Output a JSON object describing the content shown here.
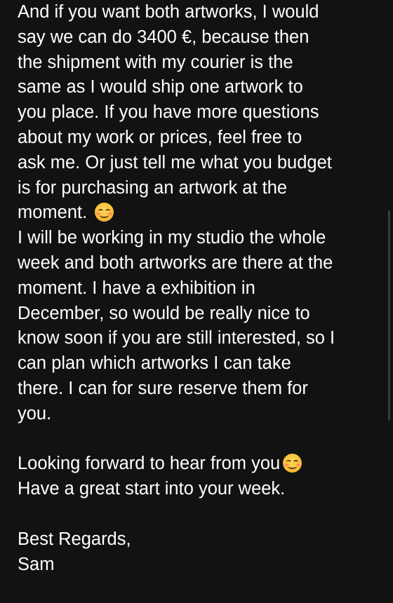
{
  "message": {
    "lines": [
      "And if you want both artworks, I would",
      "say we can do 3400 €, because then",
      "the shipment with my courier is the",
      "same as I would ship one artwork to",
      "you place. If you have more questions",
      "about my work or prices, feel free to",
      "ask me. Or just tell me what you budget",
      "is for purchasing an artwork at the",
      "moment.",
      "I will be working in my studio the whole",
      "week and both artworks are there at the",
      "moment. I have a exhibition in",
      "December, so would be really nice to",
      "know soon if you are still interested, so I",
      "can plan which artworks I can take",
      "there. I can for sure reserve them for",
      "you.",
      "Looking forward to hear from you",
      "Have a great start into your week.",
      "Best Regards,",
      "Sam"
    ],
    "emoji_icon": "smiling-face-icon"
  },
  "colors": {
    "background": "#121212",
    "text": "#ffffff"
  }
}
